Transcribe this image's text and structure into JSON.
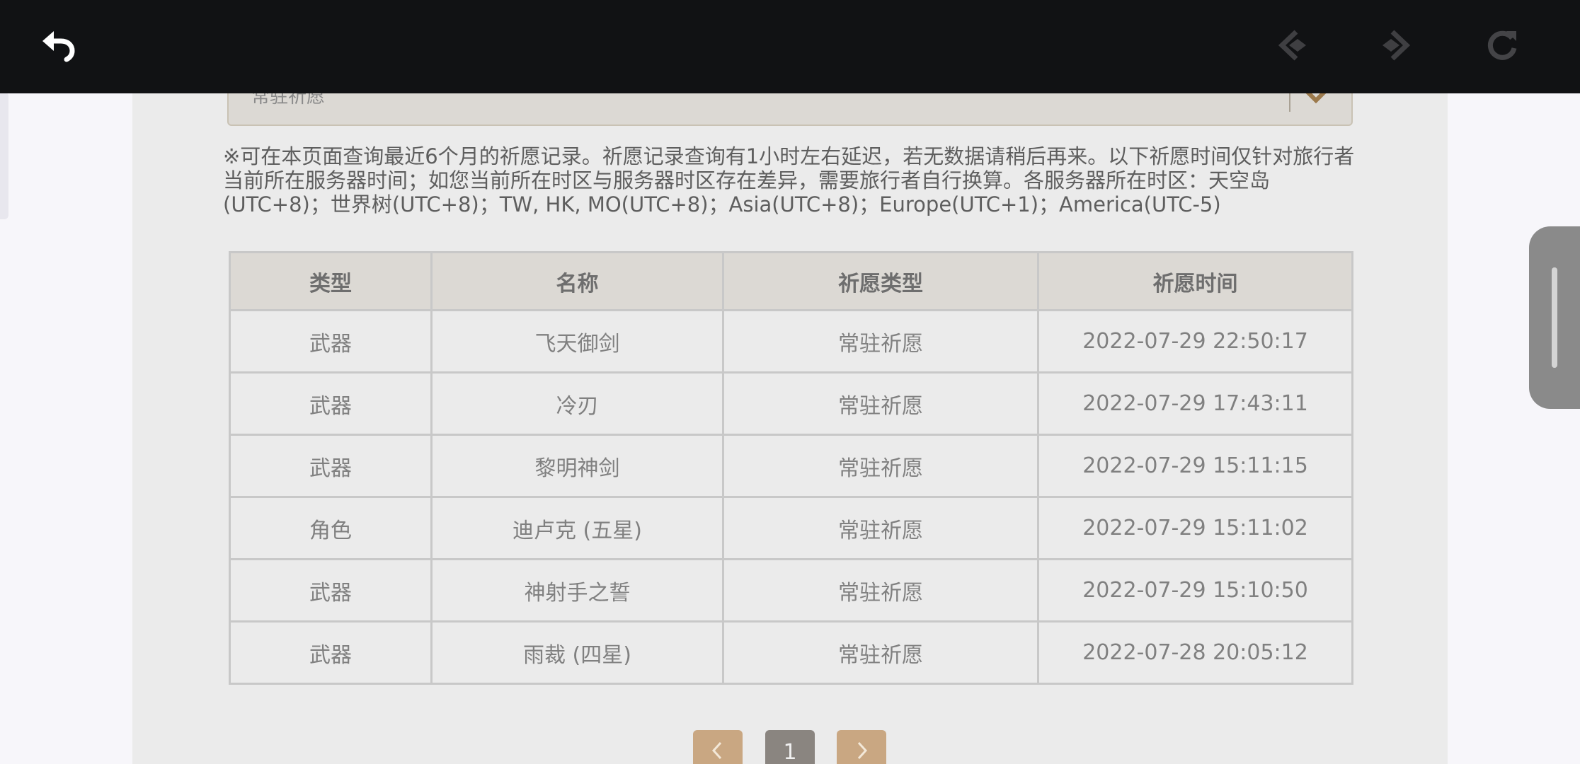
{
  "filter": {
    "selected": "常驻祈愿"
  },
  "notice": "※可在本页面查询最近6个月的祈愿记录。祈愿记录查询有1小时左右延迟，若无数据请稍后再来。以下祈愿时间仅针对旅行者当前所在服务器时间；如您当前所在时区与服务器时区存在差异，需要旅行者自行换算。各服务器所在时区：天空岛(UTC+8)；世界树(UTC+8)；TW, HK, MO(UTC+8)；Asia(UTC+8)；Europe(UTC+1)；America(UTC-5)",
  "table": {
    "headers": [
      "类型",
      "名称",
      "祈愿类型",
      "祈愿时间"
    ],
    "rows": [
      {
        "type": "武器",
        "name": "飞天御剑",
        "wish": "常驻祈愿",
        "time": "2022-07-29 22:50:17"
      },
      {
        "type": "武器",
        "name": "冷刃",
        "wish": "常驻祈愿",
        "time": "2022-07-29 17:43:11"
      },
      {
        "type": "武器",
        "name": "黎明神剑",
        "wish": "常驻祈愿",
        "time": "2022-07-29 15:11:15"
      },
      {
        "type": "角色",
        "name": "迪卢克 (五星)",
        "wish": "常驻祈愿",
        "time": "2022-07-29 15:11:02"
      },
      {
        "type": "武器",
        "name": "神射手之誓",
        "wish": "常驻祈愿",
        "time": "2022-07-29 15:10:50"
      },
      {
        "type": "武器",
        "name": "雨裁 (四星)",
        "wish": "常驻祈愿",
        "time": "2022-07-28 20:05:12"
      }
    ]
  },
  "pagination": {
    "current": "1",
    "prev_icon": "chevron-left-icon",
    "next_icon": "chevron-right-icon"
  },
  "toolbar": {
    "icons": [
      "back-icon",
      "prev-page-icon",
      "next-page-icon",
      "reload-icon"
    ]
  },
  "colors": {
    "five_star": "#c4692a",
    "four_star": "#a259e0",
    "pager_active": "#8a8580",
    "pager_button": "#c9a782"
  }
}
